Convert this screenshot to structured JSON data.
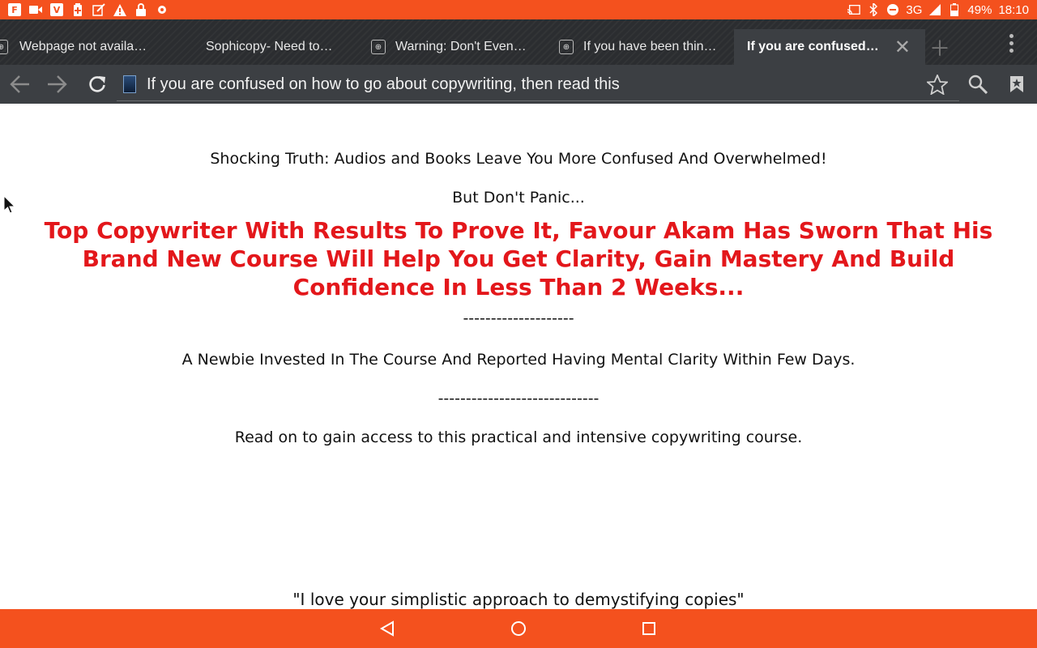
{
  "status_bar": {
    "icons_left": [
      "flipboard-icon",
      "video-icon",
      "vimeo-icon",
      "battery-saver-icon",
      "edit-icon",
      "warning-icon",
      "lock-icon",
      "update-icon"
    ],
    "icons_right": [
      "cast-icon",
      "bluetooth-icon",
      "dnd-icon",
      "signal-icon",
      "battery-icon"
    ],
    "network": "3G",
    "battery": "49%",
    "time": "18:10"
  },
  "tabs": [
    {
      "title": "Webpage not availa…",
      "active": false
    },
    {
      "title": "Sophicopy- Need to…",
      "active": false
    },
    {
      "title": "Warning: Don't Even…",
      "active": false
    },
    {
      "title": "If you have been thin…",
      "active": false
    },
    {
      "title": "If you are confused…",
      "active": true
    }
  ],
  "toolbar": {
    "url_text": "If you are confused on how to go about copywriting, then read this"
  },
  "page": {
    "line1": "Shocking Truth: Audios and Books Leave You More Confused And Overwhelmed!",
    "line2": "But Don't Panic...",
    "headline": "Top Copywriter With Results To Prove It, Favour Akam Has Sworn That His Brand New Course Will Help You Get Clarity, Gain Mastery And Build Confidence In Less Than 2 Weeks...",
    "dashes1": "--------------------",
    "line3": "A Newbie Invested In The Course And Reported Having Mental Clarity Within Few Days.",
    "dashes2": "-----------------------------",
    "line4": "Read on to gain access to this practical and intensive copywriting course.",
    "quote": "\"I love your simplistic approach to demystifying copies\""
  },
  "colors": {
    "accent": "#f4511e",
    "headline": "#e3171b",
    "chrome_dark": "#2b2d30",
    "toolbar": "#3c3f43"
  }
}
